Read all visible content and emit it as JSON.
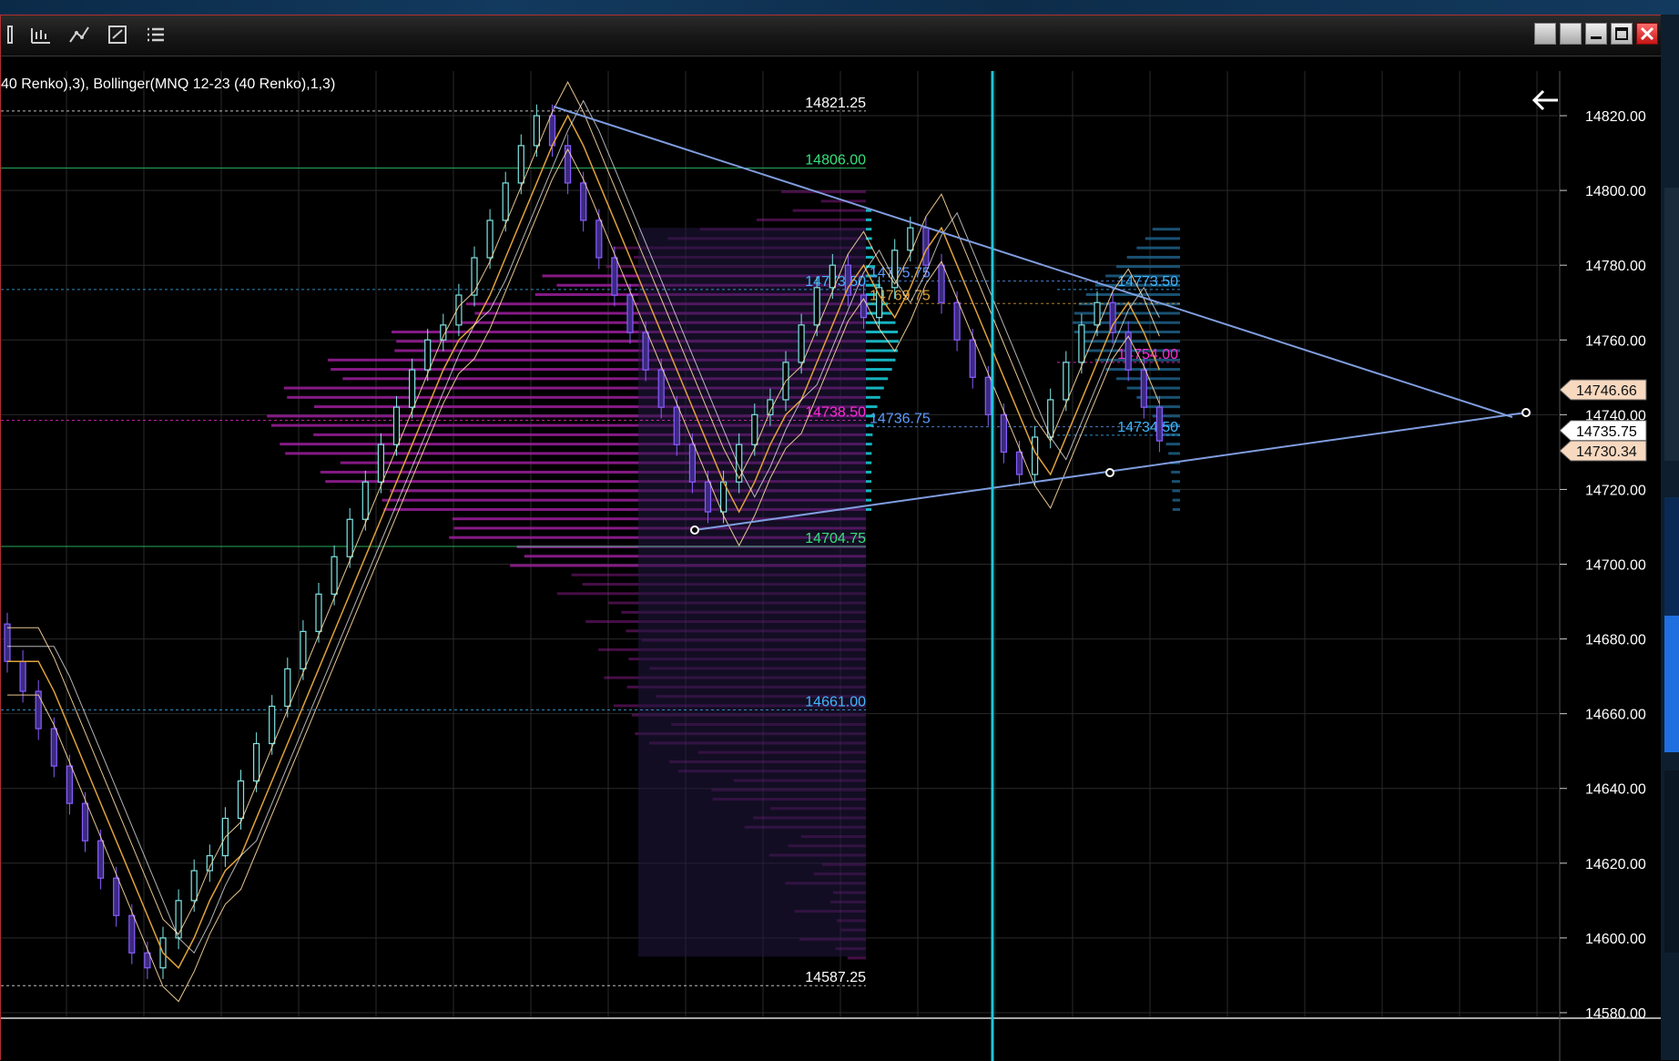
{
  "indicator_label": "40 Renko),3), Bollinger(MNQ 12-23 (40 Renko),1,3)",
  "toolbar_icons": [
    "bar-chart-icon",
    "bar-chart-icon",
    "drawing-tools-icon",
    "properties-icon",
    "list-icon"
  ],
  "window_buttons": [
    "restore-left",
    "restore-right",
    "minimize",
    "maximize",
    "close"
  ],
  "colors": {
    "background": "#000000",
    "grid": "#2a2a2a",
    "trendline": "#7f9ddf",
    "cyan_marker": "#21c5d8",
    "profile_magenta": "#9c1f9c",
    "profile_cyan": "#18c6d4",
    "candle_up": "#7fe5e5",
    "candle_down": "#8a5cff",
    "bb_mid": "#e0a23a",
    "bb_band": "#ffd9a0"
  },
  "chart_data": {
    "type": "renko",
    "instrument": "MNQ 12-23 (40 Renko)",
    "y_axis": {
      "min": 14570,
      "max": 14830,
      "ticks": [
        14820,
        14800,
        14780,
        14760,
        14740,
        14720,
        14700,
        14680,
        14660,
        14640,
        14620,
        14600,
        14580
      ],
      "tick_labels": [
        "14820.00",
        "14800.00",
        "14780.00",
        "14760.00",
        "14740.00",
        "14720.00",
        "14700.00",
        "14680.00",
        "14660.00",
        "14640.00",
        "14620.00",
        "14600.00",
        "14580.00"
      ]
    },
    "price_path": [
      14674,
      14666,
      14656,
      14646,
      14636,
      14626,
      14616,
      14606,
      14596,
      14592,
      14600,
      14610,
      14618,
      14622,
      14632,
      14642,
      14652,
      14662,
      14672,
      14682,
      14692,
      14702,
      14712,
      14722,
      14732,
      14742,
      14752,
      14760,
      14764,
      14772,
      14782,
      14792,
      14802,
      14812,
      14820,
      14812,
      14802,
      14792,
      14782,
      14772,
      14762,
      14752,
      14742,
      14732,
      14722,
      14714,
      14722,
      14732,
      14740,
      14744,
      14754,
      14764,
      14774,
      14780,
      14772,
      14766,
      14774,
      14784,
      14790,
      14780,
      14770,
      14760,
      14750,
      14740,
      14730,
      14724,
      14734,
      14744,
      14754,
      14764,
      14770,
      14762,
      14752,
      14742,
      14733
    ],
    "levels": [
      {
        "price": 14821.25,
        "label": "14821.25",
        "color": "#ffffff",
        "end": "mid"
      },
      {
        "price": 14806.0,
        "label": "14806.00",
        "color": "#35e07a",
        "end": "mid"
      },
      {
        "price": 14773.5,
        "label": "14773.50",
        "color": "#3fb6ff",
        "end": "mid"
      },
      {
        "price": 14738.5,
        "label": "14738.50",
        "color": "#ff2bd6",
        "end": "mid"
      },
      {
        "price": 14704.75,
        "label": "14704.75",
        "color": "#35e07a",
        "end": "mid"
      },
      {
        "price": 14661.0,
        "label": "14661.00",
        "color": "#3fb6ff",
        "end": "mid"
      },
      {
        "price": 14587.25,
        "label": "14587.25",
        "color": "#ffffff",
        "end": "mid"
      }
    ],
    "session_levels": [
      {
        "price": 14775.75,
        "label": "14775.75",
        "color": "#5e9cff"
      },
      {
        "price": 14769.75,
        "label": "14769.75",
        "color": "#e0a23a"
      },
      {
        "price": 14736.75,
        "label": "14736.75",
        "color": "#5e9cff"
      }
    ],
    "right_profile_levels": [
      {
        "price": 14773.5,
        "label": "14773.50",
        "color": "#3fb6ff"
      },
      {
        "price": 14754.0,
        "label": "14754.00",
        "color": "#ff2bd6"
      },
      {
        "price": 14734.5,
        "label": "14734.50",
        "color": "#3fb6ff"
      }
    ],
    "price_tags": [
      {
        "label": "14746.66",
        "price": 14746.66,
        "bg": "#f7d9c0",
        "fg": "#111111"
      },
      {
        "label": "14735.75",
        "price": 14735.75,
        "bg": "#ffffff",
        "fg": "#000000"
      },
      {
        "label": "14730.34",
        "price": 14730.34,
        "bg": "#f7d9c0",
        "fg": "#111111"
      }
    ],
    "grid": true
  }
}
